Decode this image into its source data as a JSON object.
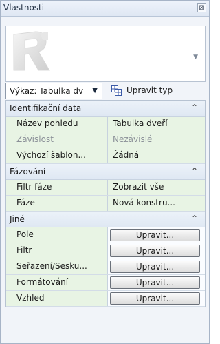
{
  "window": {
    "title": "Vlastnosti",
    "close_label": "⊠"
  },
  "type_selector": {
    "value": "Výkaz: Tabulka dv",
    "edit_type_label": "Upravit typ"
  },
  "groups": [
    {
      "label": "Identifikační data",
      "rows": [
        {
          "name": "Název pohledu",
          "value": "Tabulka dveří",
          "disabled": false
        },
        {
          "name": "Závislost",
          "value": "Nezávislé",
          "disabled": true
        },
        {
          "name": "Výchozí šablon...",
          "value": "Žádná",
          "disabled": false
        }
      ]
    },
    {
      "label": "Fázování",
      "rows": [
        {
          "name": "Filtr fáze",
          "value": "Zobrazit vše",
          "disabled": false
        },
        {
          "name": "Fáze",
          "value": "Nová konstru...",
          "disabled": false
        }
      ]
    },
    {
      "label": "Jiné",
      "rows": [
        {
          "name": "Pole",
          "button": "Upravit..."
        },
        {
          "name": "Filtr",
          "button": "Upravit..."
        },
        {
          "name": "Seřazení/Sesku...",
          "button": "Upravit..."
        },
        {
          "name": "Formátování",
          "button": "Upravit..."
        },
        {
          "name": "Vzhled",
          "button": "Upravit..."
        }
      ]
    }
  ],
  "collapse_glyph": "⌃"
}
